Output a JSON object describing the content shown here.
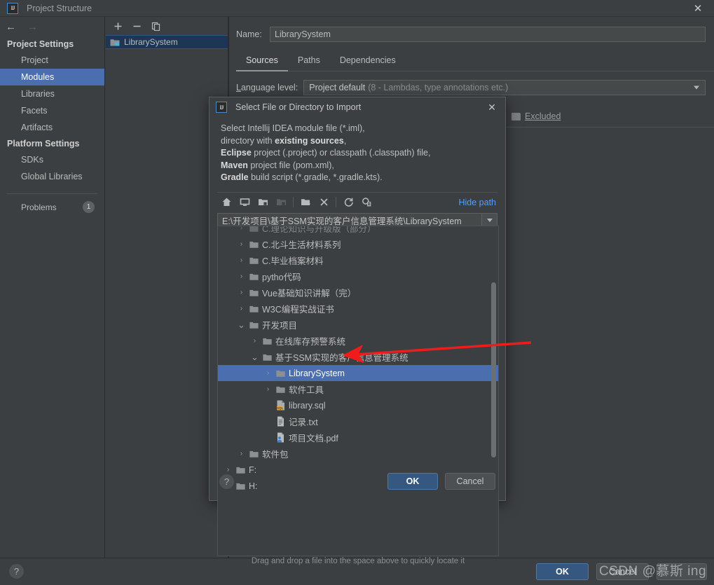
{
  "window": {
    "title": "Project Structure",
    "logo_text": "IJ",
    "close_icon": "✕"
  },
  "nav": {
    "back_icon": "←",
    "forward_icon": "→"
  },
  "sidebar": {
    "groups": [
      {
        "label": "Project Settings",
        "items": [
          {
            "label": "Project",
            "selected": false
          },
          {
            "label": "Modules",
            "selected": true
          },
          {
            "label": "Libraries",
            "selected": false
          },
          {
            "label": "Facets",
            "selected": false
          },
          {
            "label": "Artifacts",
            "selected": false
          }
        ]
      },
      {
        "label": "Platform Settings",
        "items": [
          {
            "label": "SDKs",
            "selected": false
          },
          {
            "label": "Global Libraries",
            "selected": false
          }
        ]
      }
    ],
    "problems": {
      "label": "Problems",
      "count": "1"
    }
  },
  "modules_panel": {
    "toolbar": [
      {
        "name": "add-module-button",
        "glyph": "+"
      },
      {
        "name": "remove-module-button",
        "glyph": "−"
      },
      {
        "name": "copy-module-button",
        "glyph": "❐"
      }
    ],
    "items": [
      {
        "label": "LibrarySystem",
        "selected": true
      }
    ]
  },
  "detail": {
    "name_label": "Name:",
    "name_value": "LibrarySystem",
    "tabs": [
      {
        "label": "Sources",
        "active": true
      },
      {
        "label": "Paths",
        "active": false
      },
      {
        "label": "Dependencies",
        "active": false
      }
    ],
    "language_level_label": "Language level:",
    "language_level_value": "Project default",
    "language_level_hint": "(8 - Lambdas, type annotations etc.)",
    "excluded_label": "Excluded"
  },
  "main_buttons": {
    "help": "?",
    "ok": "OK",
    "cancel": "Cancel"
  },
  "dialog": {
    "title": "Select File or Directory to Import",
    "logo_text": "IJ",
    "close_icon": "✕",
    "description_lines": [
      {
        "parts": [
          {
            "text": "Select Intellij IDEA module file (*.iml),",
            "bold": false
          }
        ]
      },
      {
        "parts": [
          {
            "text": "directory with ",
            "bold": false
          },
          {
            "text": "existing sources",
            "bold": true
          },
          {
            "text": ",",
            "bold": false
          }
        ]
      },
      {
        "parts": [
          {
            "text": "Eclipse",
            "bold": true
          },
          {
            "text": " project (.project) or classpath (.classpath) file,",
            "bold": false
          }
        ]
      },
      {
        "parts": [
          {
            "text": "Maven",
            "bold": true
          },
          {
            "text": " project file (pom.xml),",
            "bold": false
          }
        ]
      },
      {
        "parts": [
          {
            "text": "Gradle",
            "bold": true
          },
          {
            "text": " build script (*.gradle, *.gradle.kts).",
            "bold": false
          }
        ]
      }
    ],
    "toolbar": [
      {
        "name": "home-icon",
        "enabled": true
      },
      {
        "name": "desktop-icon",
        "enabled": true
      },
      {
        "name": "project-folder-icon",
        "enabled": true
      },
      {
        "name": "module-folder-icon",
        "enabled": false
      },
      {
        "name": "new-folder-icon",
        "enabled": true
      },
      {
        "name": "delete-icon",
        "enabled": true
      },
      {
        "name": "refresh-icon",
        "enabled": true
      },
      {
        "name": "show-hidden-files-icon",
        "enabled": true
      }
    ],
    "hide_path_label": "Hide path",
    "path_value": "E:\\开发项目\\基于SSM实现的客户信息管理系统\\LibrarySystem",
    "tree": [
      {
        "label": "C.理论知识与升级版（部分）",
        "indent": 1,
        "twist": "collapsed",
        "icon": "folder",
        "selected": false,
        "clipped": true
      },
      {
        "label": "C.北斗生活材料系列",
        "indent": 1,
        "twist": "collapsed",
        "icon": "folder",
        "selected": false
      },
      {
        "label": "C.毕业档案材料",
        "indent": 1,
        "twist": "collapsed",
        "icon": "folder",
        "selected": false
      },
      {
        "label": "pytho代码",
        "indent": 1,
        "twist": "collapsed",
        "icon": "folder",
        "selected": false
      },
      {
        "label": "Vue基础知识讲解（完）",
        "indent": 1,
        "twist": "collapsed",
        "icon": "folder",
        "selected": false
      },
      {
        "label": "W3C编程实战证书",
        "indent": 1,
        "twist": "collapsed",
        "icon": "folder",
        "selected": false
      },
      {
        "label": "开发项目",
        "indent": 1,
        "twist": "expanded",
        "icon": "folder",
        "selected": false
      },
      {
        "label": "在线库存预警系统",
        "indent": 2,
        "twist": "collapsed",
        "icon": "folder",
        "selected": false
      },
      {
        "label": "基于SSM实现的客户信息管理系统",
        "indent": 2,
        "twist": "expanded",
        "icon": "folder",
        "selected": false
      },
      {
        "label": "LibrarySystem",
        "indent": 3,
        "twist": "collapsed",
        "icon": "folder",
        "selected": true
      },
      {
        "label": "软件工具",
        "indent": 3,
        "twist": "collapsed",
        "icon": "folder",
        "selected": false
      },
      {
        "label": "library.sql",
        "indent": 3,
        "twist": "none",
        "icon": "sql",
        "selected": false
      },
      {
        "label": "记录.txt",
        "indent": 3,
        "twist": "none",
        "icon": "txt",
        "selected": false
      },
      {
        "label": "项目文档.pdf",
        "indent": 3,
        "twist": "none",
        "icon": "pdf",
        "selected": false
      },
      {
        "label": "软件包",
        "indent": 1,
        "twist": "collapsed",
        "icon": "folder",
        "selected": false
      },
      {
        "label": "F:",
        "indent": 0,
        "twist": "collapsed",
        "icon": "folder",
        "selected": false
      },
      {
        "label": "H:",
        "indent": 0,
        "twist": "collapsed",
        "icon": "folder",
        "selected": false
      }
    ],
    "drag_hint": "Drag and drop a file into the space above to quickly locate it",
    "help": "?",
    "ok": "OK",
    "cancel": "Cancel"
  },
  "annotation": {
    "arrow_color": "#f01c1c"
  },
  "watermark": {
    "text": "CSDN @慕斯 ing"
  },
  "colors": {
    "selection": "#4b6eaf",
    "primary_button": "#365880",
    "link": "#589df6",
    "panel": "#3c3f41",
    "input": "#45494a"
  }
}
